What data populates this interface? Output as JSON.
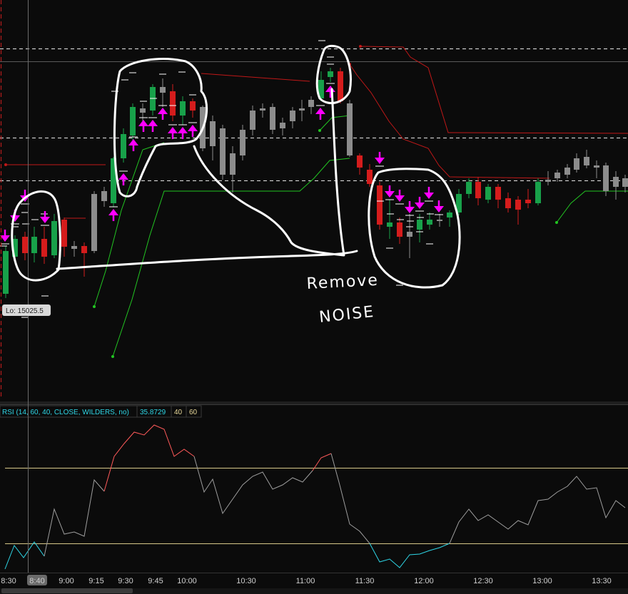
{
  "chart_data": {
    "type": "candlestick",
    "price_panel": {
      "lo_label": "Lo: 15025.5",
      "dashed_levels": [
        {
          "name": "upper-dashed-level"
        },
        {
          "name": "middle-dashed-level"
        },
        {
          "name": "lower-dashed-level"
        }
      ]
    },
    "rsi_panel": {
      "study": "RSI (14, 60, 40, CLOSE, WILDERS, no)",
      "value": "35.8729",
      "lower": "40",
      "upper": "60",
      "colors": {
        "overbought": "#ff5a5a",
        "neutral": "#9e9e9e",
        "oversold": "#2ed6e6",
        "levels": "#d8c88a"
      }
    },
    "time_axis": {
      "ticks": [
        "8:30",
        "9:00",
        "9:15",
        "9:30",
        "9:45",
        "10:00",
        "10:30",
        "11:00",
        "11:30",
        "12:00",
        "12:30",
        "13:00",
        "13:30"
      ],
      "cursor_label": "8:40"
    },
    "annotations": {
      "line1": "Remove",
      "line2": "NOISE"
    },
    "colors": {
      "up": "#18a14a",
      "down": "#d51c1c",
      "neutral": "#8c8c8c",
      "signal_arrow": "#ff00ff",
      "stop_red": "#c01818",
      "stop_green": "#22c522"
    }
  }
}
